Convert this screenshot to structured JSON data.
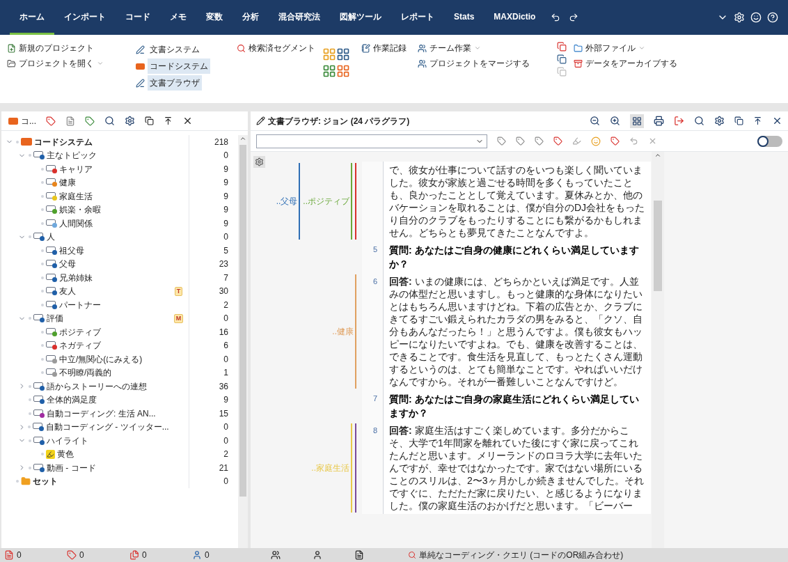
{
  "menu_tabs": [
    {
      "label": "ホーム",
      "selected": true
    },
    {
      "label": "インポート",
      "selected": false
    },
    {
      "label": "コード",
      "selected": false
    },
    {
      "label": "メモ",
      "selected": false
    },
    {
      "label": "変数",
      "selected": false
    },
    {
      "label": "分析",
      "selected": false
    },
    {
      "label": "混合研究法",
      "selected": false
    },
    {
      "label": "図解ツール",
      "selected": false
    },
    {
      "label": "レポート",
      "selected": false
    },
    {
      "label": "Stats",
      "selected": false
    },
    {
      "label": "MAXDictio",
      "selected": false
    }
  ],
  "ribbon": {
    "project": [
      {
        "label": "新規のプロジェクト",
        "dropdown": false
      },
      {
        "label": "プロジェクトを開く",
        "dropdown": true
      }
    ],
    "windows": [
      {
        "label": "文書システム",
        "selected": false
      },
      {
        "label": "コードシステム",
        "selected": true
      },
      {
        "label": "文書ブラウザ",
        "selected": true
      }
    ],
    "retrieved": {
      "label": "検索済セグメント"
    },
    "logbook": {
      "label": "作業記録"
    },
    "team": [
      {
        "label": "チーム作業",
        "dropdown": true
      },
      {
        "label": "プロジェクトをマージする",
        "dropdown": false
      }
    ],
    "files": [
      {
        "label": "外部ファイル",
        "dropdown": true
      },
      {
        "label": "データをアーカイブする",
        "dropdown": false
      }
    ]
  },
  "code_system": {
    "title": "コ...",
    "items": [
      {
        "label": "コードシステム",
        "kind": "root",
        "count": "218",
        "expanded": true,
        "children": [
          {
            "label": "主なトピック",
            "kind": "code",
            "color": "#1f5fa8",
            "count": "0",
            "expanded": true,
            "children": [
              {
                "label": "キャリア",
                "kind": "code",
                "color": "#d9302c",
                "count": "9"
              },
              {
                "label": "健康",
                "kind": "code",
                "color": "#e8851c",
                "count": "9"
              },
              {
                "label": "家庭生活",
                "kind": "code",
                "color": "#e8c51c",
                "count": "9"
              },
              {
                "label": "娯楽・余暇",
                "kind": "code",
                "color": "#4fa02c",
                "count": "9"
              },
              {
                "label": "人間関係",
                "kind": "code",
                "color": "#6fa8dc",
                "count": "9"
              }
            ]
          },
          {
            "label": "人",
            "kind": "code",
            "color": "#1f5fa8",
            "count": "0",
            "expanded": true,
            "children": [
              {
                "label": "祖父母",
                "kind": "code",
                "color": "#1f5fa8",
                "count": "5"
              },
              {
                "label": "父母",
                "kind": "code",
                "color": "#1f5fa8",
                "count": "23"
              },
              {
                "label": "兄弟姉妹",
                "kind": "code",
                "color": "#1f5fa8",
                "count": "7"
              },
              {
                "label": "友人",
                "kind": "code",
                "color": "#1f5fa8",
                "count": "30",
                "memo": "T"
              },
              {
                "label": "パートナー",
                "kind": "code",
                "color": "#1f5fa8",
                "count": "2"
              }
            ]
          },
          {
            "label": "評価",
            "kind": "code",
            "color": "#1f5fa8",
            "count": "0",
            "memo": "M",
            "expanded": true,
            "children": [
              {
                "label": "ポジティブ",
                "kind": "code",
                "color": "#4fa02c",
                "count": "16"
              },
              {
                "label": "ネガティブ",
                "kind": "code",
                "color": "#d9302c",
                "count": "6"
              },
              {
                "label": "中立/無関心(にみえる)",
                "kind": "code",
                "color": "#9a9a9a",
                "count": "0"
              },
              {
                "label": "不明瞭/両義的",
                "kind": "code",
                "color": "#9a9a9a",
                "count": "1"
              }
            ]
          },
          {
            "label": "語からストーリーへの連想",
            "kind": "code",
            "color": "#1f5fa8",
            "count": "36",
            "expanded": false
          },
          {
            "label": "全体的満足度",
            "kind": "code",
            "color": "#1f5fa8",
            "count": "9"
          },
          {
            "label": "自動コーディング: 生活 AN...",
            "kind": "code",
            "color": "#a02ca0",
            "count": "15"
          },
          {
            "label": "自動コーディング - ツイッター...",
            "kind": "code",
            "color": "#1f5fa8",
            "count": "0",
            "expanded": false
          },
          {
            "label": "ハイライト",
            "kind": "code",
            "color": "#1f5fa8",
            "count": "0",
            "expanded": true,
            "children": [
              {
                "label": "黄色",
                "kind": "highlight",
                "color": "#f2d21b",
                "count": "2"
              }
            ]
          },
          {
            "label": "動画 - コード",
            "kind": "code",
            "color": "#1f5fa8",
            "count": "21",
            "expanded": false
          }
        ]
      },
      {
        "label": "セット",
        "kind": "set",
        "count": "0"
      }
    ]
  },
  "browser": {
    "title": "文書ブラウザ: ジョン (24 パラグラフ)",
    "edit_mode_on": false,
    "paragraphs": [
      {
        "kind": "answer",
        "text": "で、彼女が仕事について話すのをいつも楽しく聞いていました。彼女が家族と過ごせる時間を多くもっていたことも、良かったこととして覚えています。夏休みとか、他のバケーションを取れることは、僕が自分のDJ会社をもったり自分のクラブをもったりすることにも繋がるかもしれません。どちらとも夢見てきたことなんですよ。",
        "codings": [
          {
            "label": "..父母",
            "color": "#2f6fb5"
          },
          {
            "label": "..ポジティブ",
            "color": "#6aa83a"
          },
          {
            "color": "#d9302c"
          }
        ]
      },
      {
        "number": "5",
        "kind": "question",
        "prefix": "質問:",
        "text": "あなたはご自身の健康にどれくらい満足していますか？"
      },
      {
        "number": "6",
        "kind": "answer",
        "prefix": "回答:",
        "text": "いまの健康には、どちらかといえば満足です。人並みの体型だと思いますし。もっと健康的な身体になりたいとはもちろん思いますけどね。下着の広告とか、クラブにきてるすごい鍛えられたカラダの男をみると、「クソ、自分もあんなだったら！」と思うんですよ。僕も彼女もハッピーになりたいですよね。でも、健康を改善することは、できることです。食生活を見直して、もっとたくさん運動するというのは、とても簡単なことです。やればいいだけなんですから。それが一番難しいことなんですけど。",
        "codings": [
          {
            "label": "..健康",
            "color": "#e0a060"
          }
        ]
      },
      {
        "number": "7",
        "kind": "question",
        "prefix": "質問:",
        "text": "あなたはご自身の家庭生活にどれくらい満足していますか？"
      },
      {
        "number": "8",
        "kind": "answer",
        "prefix": "回答:",
        "text": "家庭生活はすごく楽しめています。多分だからこそ、大学で1年間家を離れていた後にすぐ家に戻ってこれたんだと思います。メリーランドのロヨラ大学に去年いたんですが、幸せではなかったです。家ではない場所にいることのスリルは、2〜3ヶ月かしか続きませんでした。それですぐに、ただただ家に戻りたい、と感じるようになりました。僕の家庭生活のおかげだと思います。「ビーバー",
        "codings": [
          {
            "label": "..家庭生活",
            "color": "#e8c84a"
          },
          {
            "color": "#7a4a9a"
          }
        ]
      }
    ]
  },
  "status_bar": {
    "counts": [
      {
        "kind": "documents",
        "value": "0"
      },
      {
        "kind": "codes",
        "value": "0"
      },
      {
        "kind": "segments",
        "value": "0"
      },
      {
        "kind": "users",
        "value": "0"
      }
    ],
    "query": "単純なコーディング・クエリ (コードのOR組み合わせ)"
  }
}
